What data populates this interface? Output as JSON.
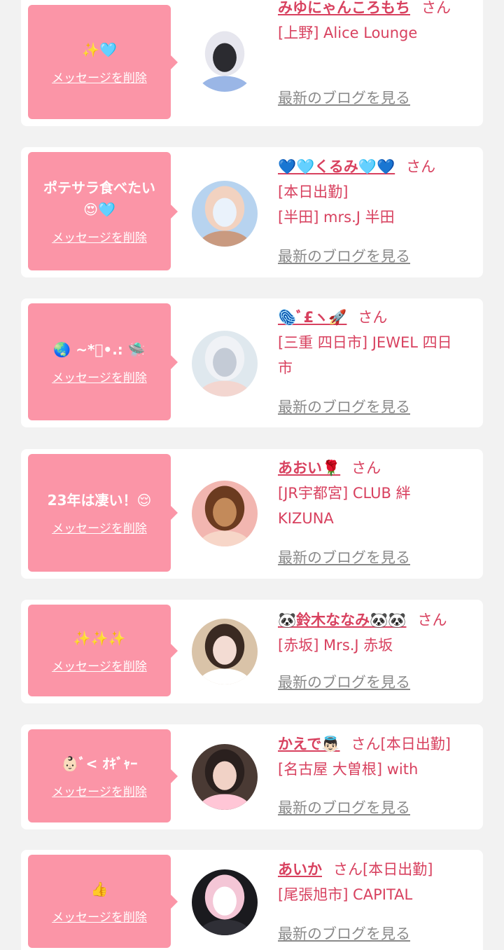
{
  "delete_label": "メッセージを削除",
  "blog_label": "最新のブログを見る",
  "san_label": "さん",
  "colors": {
    "accent": "#d8415f",
    "bubble": "#fb95a7",
    "background": "#f2f2f2",
    "link_gray": "#8a8a8a"
  },
  "items": [
    {
      "message": [
        "✨🩵"
      ],
      "name": "みゆにゃんころもち",
      "lines": [
        "[上野] Alice Lounge"
      ],
      "avatar_colors": [
        "#ffffff",
        "#e6e6ee",
        "#2b2b30",
        "#9ab6e6"
      ]
    },
    {
      "message": [
        "ポテサラ食べたい",
        "😍🩵"
      ],
      "name": "💙🩵くるみ🩵💙",
      "lines": [
        "[本日出勤]",
        "[半田] mrs.J 半田"
      ],
      "avatar_colors": [
        "#b7d3ef",
        "#f2d2c0",
        "#eaf2fb",
        "#c99a80"
      ]
    },
    {
      "message": [
        "🌏 ~*ﾟ•.: 🛸"
      ],
      "name": "🫆ﾞ£ヽ🚀",
      "lines": [
        "[三重 四日市] JEWEL 四日",
        "市"
      ],
      "avatar_colors": [
        "#dfe8ee",
        "#f0f2f6",
        "#c4cbd6",
        "#f3d6d0"
      ]
    },
    {
      "message": [
        "23年は凄い！😌"
      ],
      "name": "あおい🌹",
      "lines": [
        "[JR宇都宮] CLUB 絆",
        "KIZUNA"
      ],
      "avatar_colors": [
        "#f2b6b0",
        "#6b3b20",
        "#c38a5a",
        "#f7d6c8"
      ]
    },
    {
      "message": [
        "✨✨✨"
      ],
      "name": "🐼鈴木ななみ🐼🐼",
      "lines": [
        "[赤坂] Mrs.J 赤坂"
      ],
      "avatar_colors": [
        "#d9c3a8",
        "#3a2a22",
        "#f3dcd3",
        "#ffffff"
      ]
    },
    {
      "message": [
        "👶🏻ﾞ< ｵｷﾞｬｰ"
      ],
      "name": "かえで👼🏻",
      "lines": [
        "[名古屋 大曽根] with"
      ],
      "name_suffix": "[本日出勤]",
      "avatar_colors": [
        "#4a3a34",
        "#2a201e",
        "#f1d2c6",
        "#ffc6d6"
      ]
    },
    {
      "message": [
        "👍"
      ],
      "name": "あいか",
      "lines": [
        "[尾張旭市] CAPITAL"
      ],
      "name_suffix": "[本日出勤]",
      "avatar_colors": [
        "#1a1a1e",
        "#f4c6d6",
        "#ffffff",
        "#2f2f36"
      ]
    }
  ]
}
